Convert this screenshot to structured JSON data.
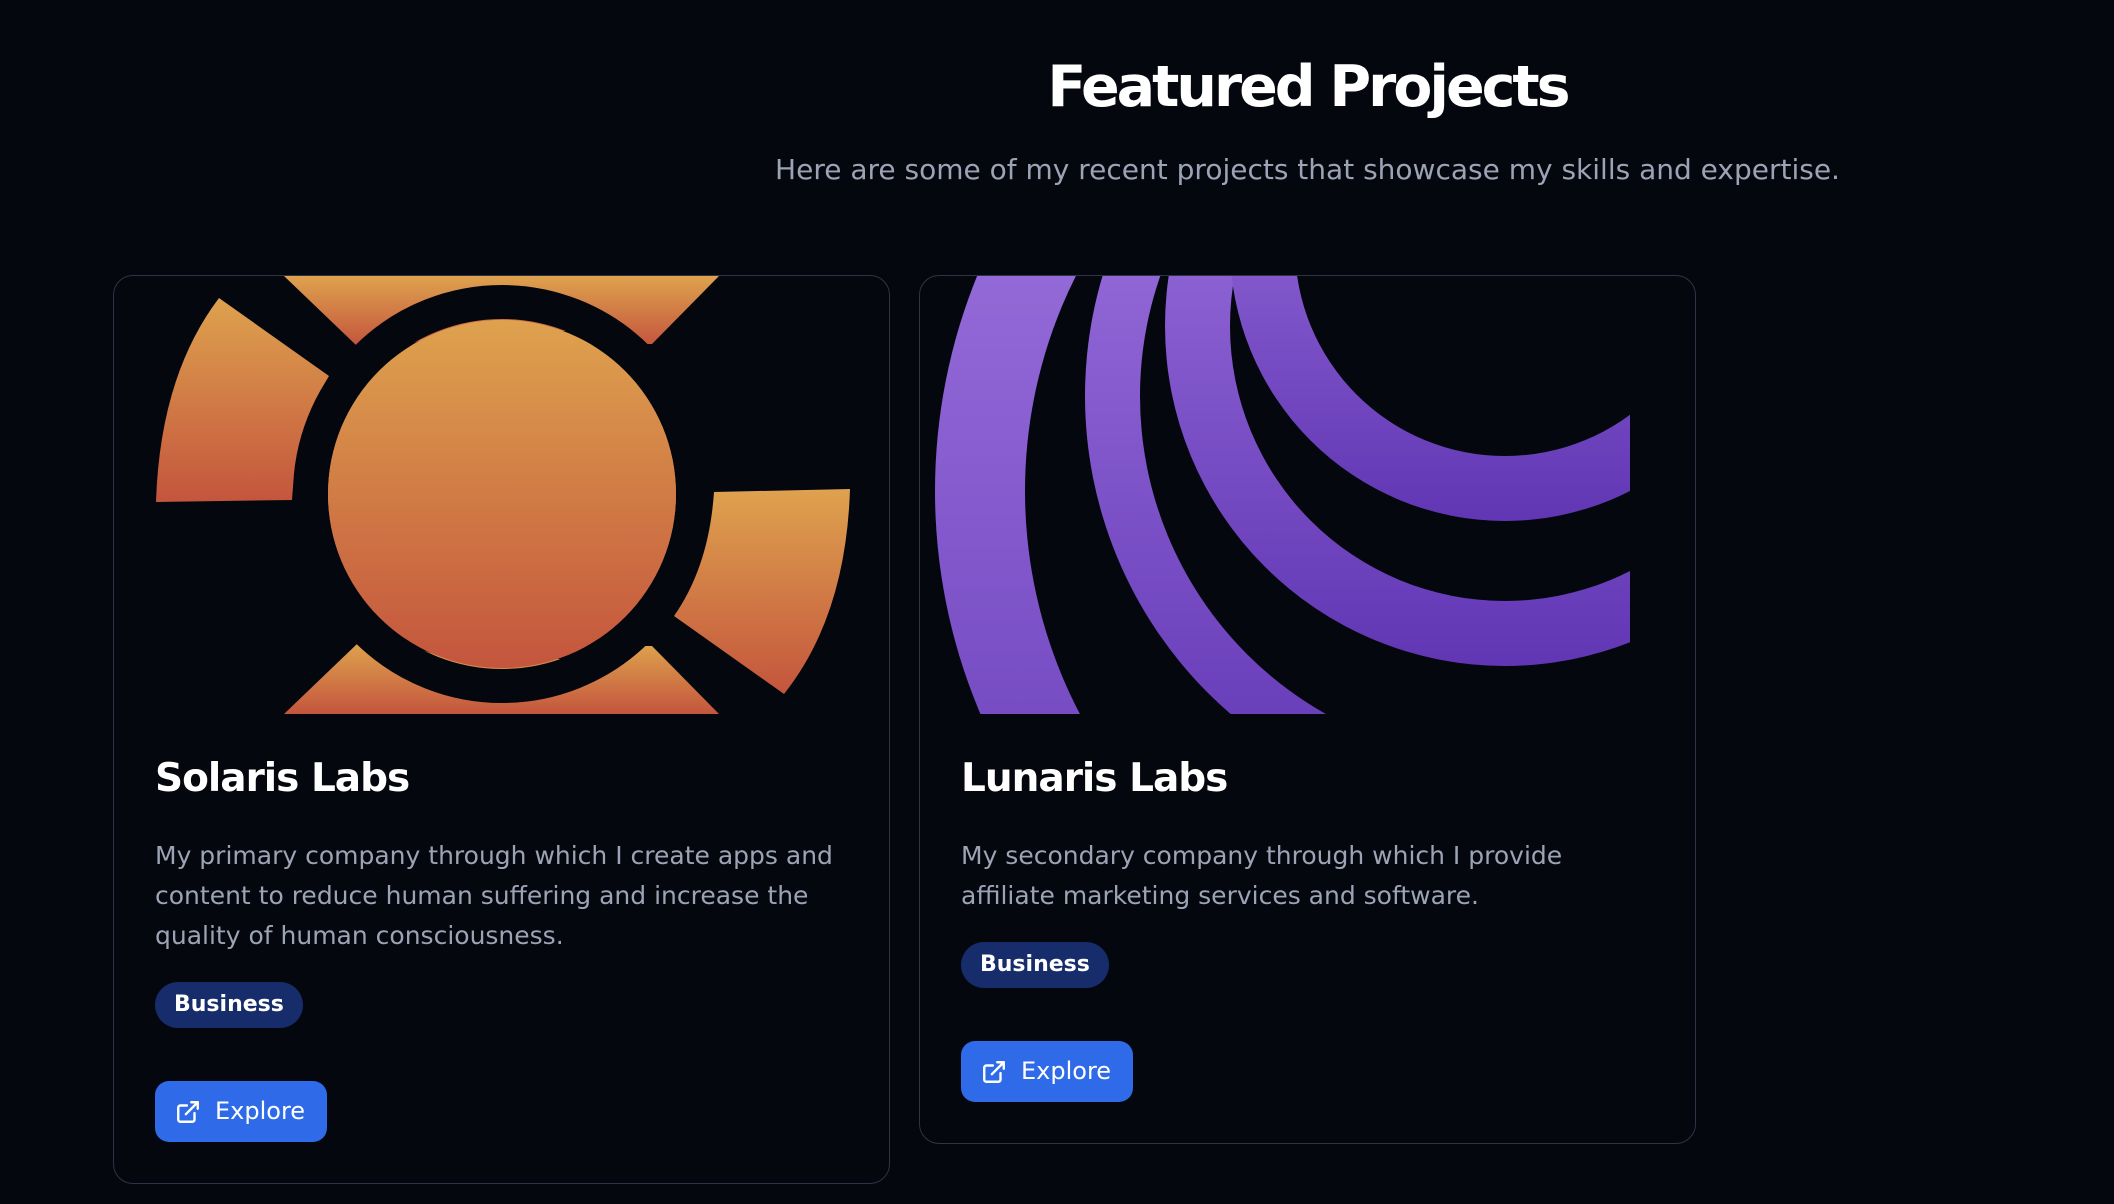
{
  "header": {
    "title": "Featured Projects",
    "subtitle": "Here are some of my recent projects that showcase my skills and expertise."
  },
  "projects": [
    {
      "title": "Solaris Labs",
      "description": "My primary company through which I create apps and content to reduce human suffering and increase the quality of human consciousness.",
      "tag": "Business",
      "button_label": "Explore",
      "button_icon": "external-link-icon",
      "logo": "sun-logo",
      "colors": {
        "gradient_top": "#dea24e",
        "gradient_bottom": "#c4553d"
      }
    },
    {
      "title": "Lunaris Labs",
      "description": "My secondary company through which I provide affiliate marketing services and software.",
      "tag": "Business",
      "button_label": "Explore",
      "button_icon": "external-link-icon",
      "logo": "moon-logo",
      "colors": {
        "gradient_top": "#aa80e8",
        "gradient_bottom": "#6136b4"
      }
    }
  ],
  "colors": {
    "background": "#05070f",
    "card_border": "#2e3446",
    "tag_background": "#172c6b",
    "button_background": "#2f6be8",
    "muted_text": "#9ca3b4"
  }
}
